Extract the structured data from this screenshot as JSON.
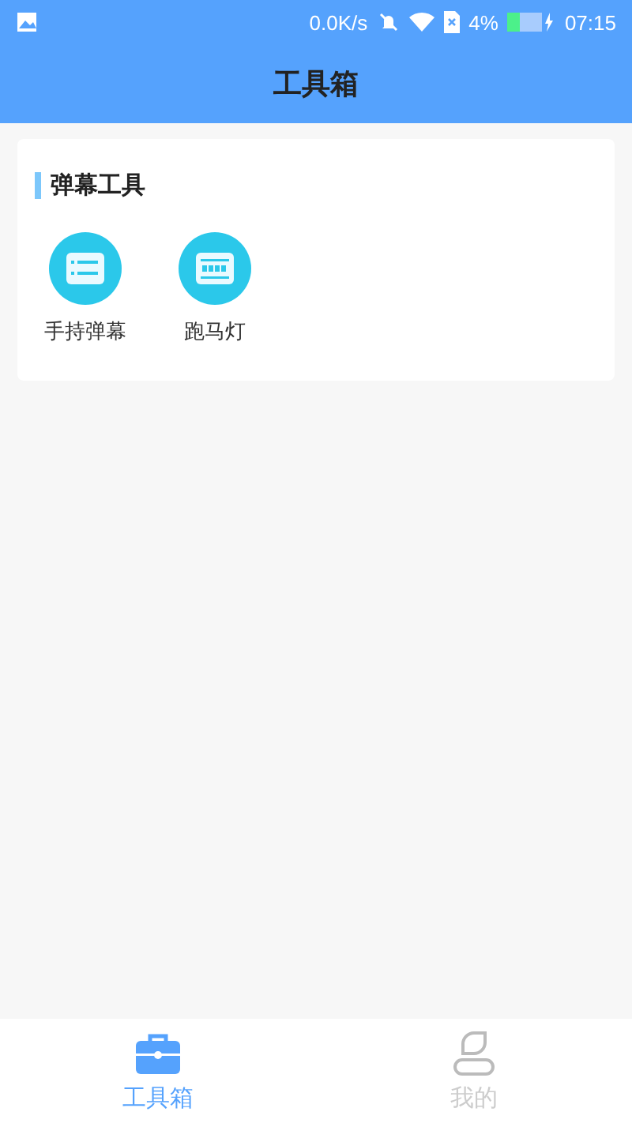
{
  "status_bar": {
    "speed": "0.0K/s",
    "battery": "4%",
    "time": "07:15"
  },
  "header": {
    "title": "工具箱"
  },
  "section": {
    "title": "弹幕工具",
    "tools": [
      {
        "label": "手持弹幕",
        "kind": "lines"
      },
      {
        "label": "跑马灯",
        "kind": "marquee"
      }
    ]
  },
  "tab_bar": [
    {
      "label": "工具箱",
      "kind": "toolbox",
      "selected": true
    },
    {
      "label": "我的",
      "kind": "person",
      "selected": false
    }
  ]
}
